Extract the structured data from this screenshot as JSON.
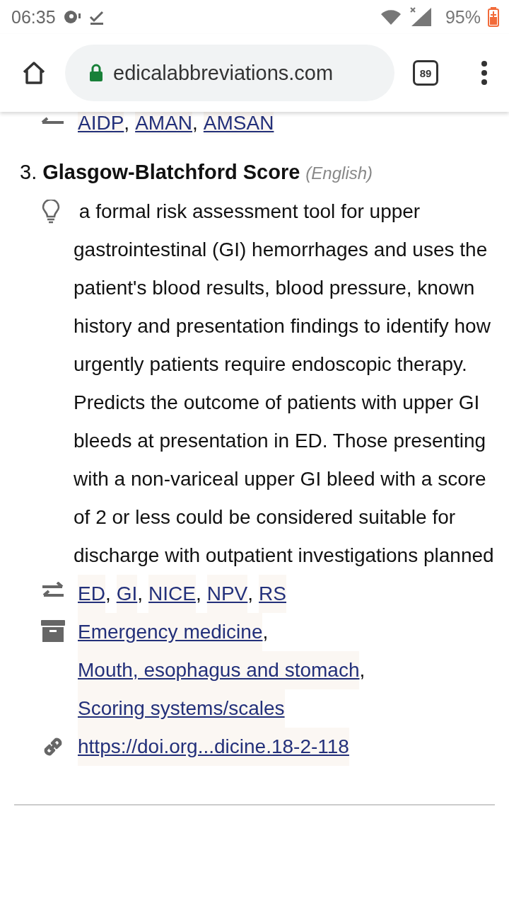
{
  "status_bar": {
    "time": "06:35",
    "battery": "95%"
  },
  "separator": ",",
  "browser": {
    "url": "edicalabbreviations.com",
    "tab_count": "89"
  },
  "previous_entry": {
    "related": [
      "AIDP",
      "AMAN",
      "AMSAN"
    ]
  },
  "entry": {
    "number": "3.",
    "title": "Glasgow-Blatchford Score",
    "language": "(English)",
    "description": "a formal risk assessment tool for upper gastrointestinal (GI) hemorrhages and uses the patient's blood results, blood pressure, known history and presentation findings to identify how urgently patients require endoscopic therapy. Predicts the outcome of patients with upper GI bleeds at presentation in ED. Those presenting with a non-variceal upper GI bleed with a score of 2 or less could be considered suitable for discharge with outpatient investigations planned",
    "related": [
      "ED",
      "GI",
      "NICE",
      "NPV",
      "RS"
    ],
    "categories": [
      "Emergency medicine",
      "Mouth, esophagus and stomach",
      "Scoring systems/scales"
    ],
    "source": "https://doi.org...dicine.18-2-118"
  }
}
